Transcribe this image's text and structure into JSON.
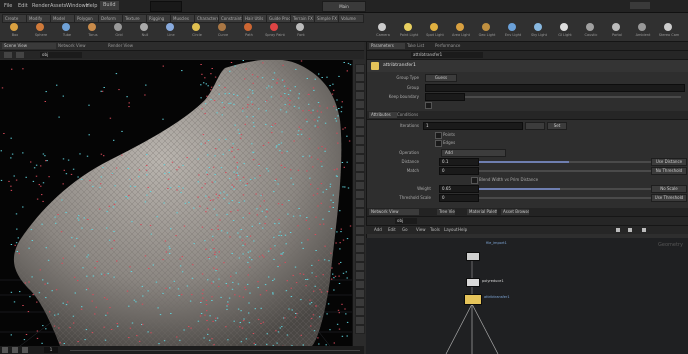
{
  "menubar": {
    "items": [
      "File",
      "Edit",
      "Render",
      "Assets",
      "Windows",
      "Help"
    ],
    "desktop": "Build",
    "search_placeholder": "",
    "main_label": "Main"
  },
  "shelf": {
    "tabs": [
      "Create",
      "Modify",
      "Model",
      "Polygon",
      "Deform",
      "Texture",
      "Rigging",
      "Muscles",
      "Characters",
      "Constraints",
      "Hair Utils",
      "Guide Process",
      "Terrain FX",
      "Simple FX",
      "Volume"
    ],
    "tools": [
      {
        "label": "Box",
        "color": "#d9a040"
      },
      {
        "label": "Sphere",
        "color": "#d07a3a"
      },
      {
        "label": "Tube",
        "color": "#6fa1d6"
      },
      {
        "label": "Torus",
        "color": "#c98b4a"
      },
      {
        "label": "Grid",
        "color": "#999999"
      },
      {
        "label": "Null",
        "color": "#aaaaaa"
      },
      {
        "label": "Line",
        "color": "#88aadd"
      },
      {
        "label": "Circle",
        "color": "#e0c050"
      },
      {
        "label": "Curve",
        "color": "#aa7744"
      },
      {
        "label": "Path",
        "color": "#cc6633"
      },
      {
        "label": "Spray Paint",
        "color": "#dd4444"
      },
      {
        "label": "Font",
        "color": "#bbbbbb"
      }
    ],
    "right_tools": [
      {
        "label": "Camera",
        "color": "#cccccc"
      },
      {
        "label": "Point Light",
        "color": "#e8d060"
      },
      {
        "label": "Spot Light",
        "color": "#e0b040"
      },
      {
        "label": "Area Light",
        "color": "#d8a040"
      },
      {
        "label": "Geo Light",
        "color": "#c09040"
      },
      {
        "label": "Env Light",
        "color": "#6aa0d8"
      },
      {
        "label": "Sky Light",
        "color": "#88b8e0"
      },
      {
        "label": "GI Light",
        "color": "#dddddd"
      },
      {
        "label": "Caustic",
        "color": "#a0a0a0"
      },
      {
        "label": "Portal",
        "color": "#bbbbbb"
      },
      {
        "label": "Ambient",
        "color": "#999999"
      },
      {
        "label": "Stereo Cam",
        "color": "#cccccc"
      }
    ]
  },
  "viewport": {
    "tabs": [
      "Scene View",
      "Network View",
      "Render View"
    ],
    "path": "obj",
    "title": "Auto Project"
  },
  "params": {
    "tabs": [
      "Parameters",
      "Take List",
      "Performance"
    ],
    "node_name": "attribtransfer1",
    "group_type_label": "Group Type",
    "group_type_value": "Guess",
    "group_label": "Group",
    "boundary_label": "Keep boundary",
    "sub_tabs": [
      "Attributes",
      "Conditions"
    ],
    "iterations_label": "Iterations",
    "iterations_value": "1",
    "options": [
      "Points",
      "Edges"
    ],
    "operation_label": "Operation",
    "operation_value": "Add",
    "distance_label": "Distance",
    "distance_value": "0.1",
    "match_label": "Match",
    "match_value": "0",
    "blend_check": "Blend Width vs Prim Distance",
    "weight_label": "Weight",
    "weight_value": "0.65",
    "scale_label": "Threshold Scale",
    "scale_value": "0",
    "side_buttons": [
      "Use Distance",
      "No Threshold",
      "No Scale",
      "Use Threshold"
    ],
    "apply_button": "Set"
  },
  "network": {
    "tabs": [
      "Network View",
      "Tree View",
      "Material Palette",
      "Asset Browser"
    ],
    "path": "obj",
    "menu": [
      "Add",
      "Edit",
      "Go",
      "View",
      "Tools",
      "Layout",
      "Help"
    ],
    "nodes": [
      {
        "name": "file_import1",
        "color": "#cfcfcf"
      },
      {
        "name": "polyreduce1",
        "color": "#d8d8d8"
      },
      {
        "name": "attribtransfer1",
        "color": "#e6c45a"
      }
    ],
    "badge": "Geometry"
  },
  "timebar": {
    "frame": "1"
  }
}
